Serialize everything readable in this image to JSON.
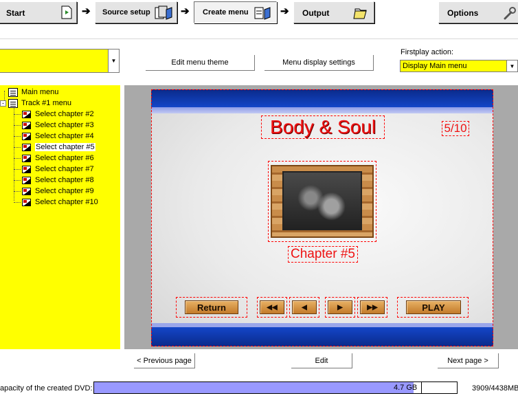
{
  "toolbar": {
    "start_label": "Start",
    "source_label": "Source setup",
    "create_label": "Create menu",
    "output_label": "Output",
    "options_label": "Options"
  },
  "top": {
    "edit_theme_label": "Edit menu theme",
    "display_settings_label": "Menu display settings",
    "firstplay_label": "Firstplay action:",
    "firstplay_value": "Display Main menu"
  },
  "tree": {
    "main_menu": "Main menu",
    "track_menu": "Track #1 menu",
    "chapters": [
      "Select chapter #2",
      "Select chapter #3",
      "Select chapter #4",
      "Select chapter #5",
      "Select chapter #6",
      "Select chapter #7",
      "Select chapter #8",
      "Select chapter #9",
      "Select chapter #10"
    ],
    "selected_index": 3
  },
  "preview": {
    "title": "Body & Soul",
    "page_counter": "5/10",
    "chapter_label": "Chapter #5",
    "return_label": "Return",
    "play_label": "PLAY",
    "btn_first": "◀◀",
    "btn_prev": "◀",
    "btn_next": "▶",
    "btn_last": "▶▶"
  },
  "nav": {
    "prev_label": "< Previous page",
    "edit_label": "Edit",
    "next_label": "Next page >"
  },
  "status": {
    "capacity_label": "apacity of the created DVD:",
    "size_label": "4.7 GB",
    "used_label": "3909/4438MB",
    "fill_fraction": 0.881
  },
  "colors": {
    "highlight": "#ffff00",
    "accent_red": "#ee1111",
    "bar_fill": "#9999ff"
  }
}
